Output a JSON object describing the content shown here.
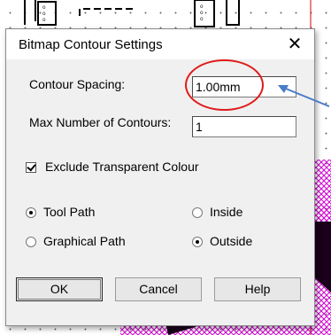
{
  "dialog": {
    "title": "Bitmap Contour Settings",
    "close_icon": "close-icon",
    "contour_spacing": {
      "label": "Contour Spacing:",
      "value": "1.00mm"
    },
    "max_contours": {
      "label": "Max Number of Contours:",
      "value": "1"
    },
    "exclude_transparent": {
      "label": "Exclude Transparent Colour",
      "checked": true
    },
    "path_type": {
      "options": [
        {
          "label": "Tool Path",
          "selected": true
        },
        {
          "label": "Graphical Path",
          "selected": false
        }
      ]
    },
    "side": {
      "options": [
        {
          "label": "Inside",
          "selected": false
        },
        {
          "label": "Outside",
          "selected": true
        }
      ]
    },
    "buttons": {
      "ok": "OK",
      "cancel": "Cancel",
      "help": "Help"
    }
  },
  "annotations": {
    "highlight_color": "#e01a1a",
    "arrow_color": "#4a7bc8"
  },
  "colors": {
    "canvas_magenta": "#d000d0",
    "canvas_red_line": "#e00000",
    "dialog_bg": "#f0f0f0"
  }
}
